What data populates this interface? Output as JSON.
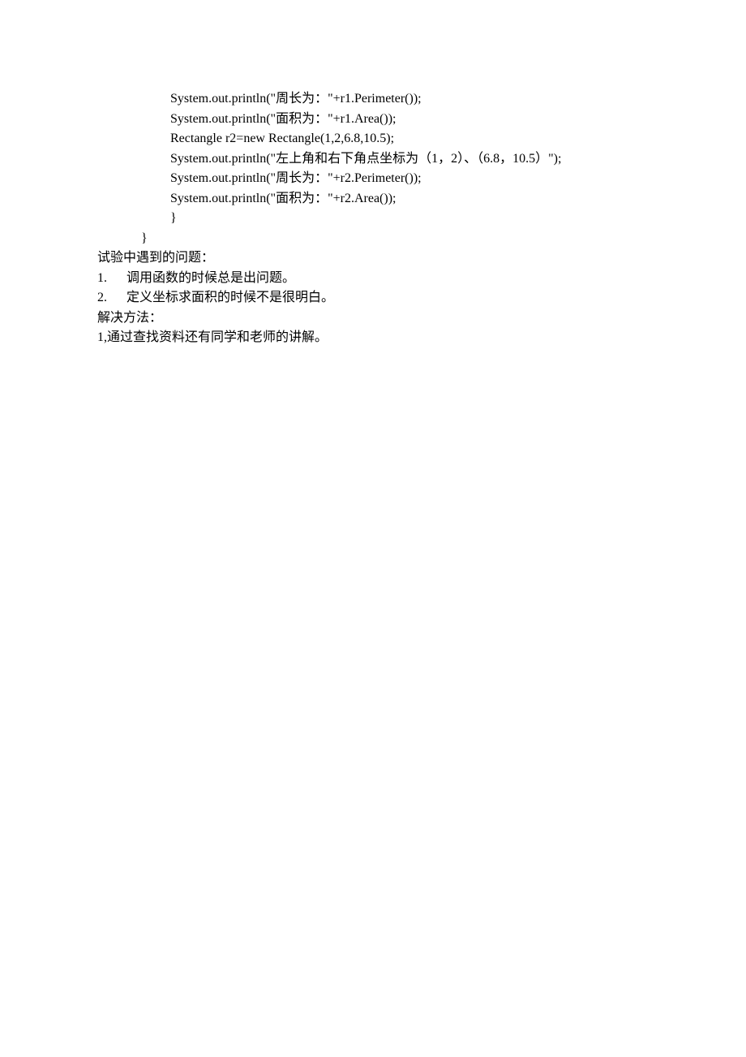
{
  "code": {
    "line1": "System.out.println(\"周长为：\"+r1.Perimeter());",
    "line2": "System.out.println(\"面积为：\"+r1.Area());",
    "line3": "Rectangle r2=new Rectangle(1,2,6.8,10.5);",
    "line4": "System.out.println(\"左上角和右下角点坐标为（1，2）、（6.8，10.5）\");",
    "line5": "System.out.println(\"周长为：\"+r2.Perimeter());",
    "line6": "System.out.println(\"面积为：\"+r2.Area());",
    "line7": "}",
    "line8": "}"
  },
  "section_problems_title": "试验中遇到的问题：",
  "problems": {
    "item1_num": "1.",
    "item1_text": "调用函数的时候总是出问题。",
    "item2_num": "2.",
    "item2_text": "定义坐标求面积的时候不是很明白。"
  },
  "section_solutions_title": "解决方法：",
  "solutions": {
    "item1": "1,通过查找资料还有同学和老师的讲解。"
  }
}
